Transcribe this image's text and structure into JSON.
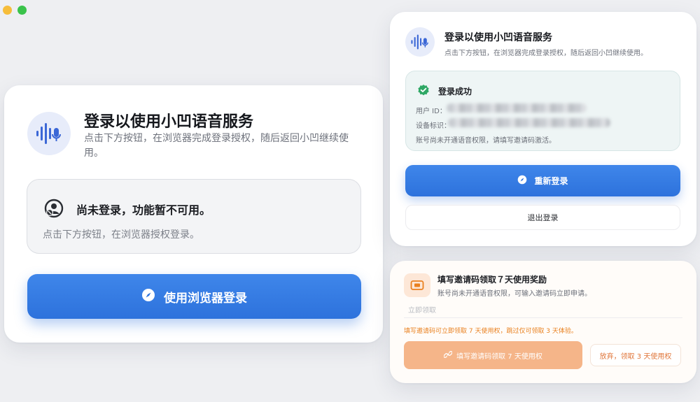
{
  "window": {
    "traffic_colors": [
      "#f6bd3b",
      "#3ac34b"
    ]
  },
  "left_card": {
    "title": "登录以使用小凹语音服务",
    "subtitle": "点击下方按钮，在浏览器完成登录授权，随后返回小凹继续使用。",
    "status": {
      "title": "尚未登录，功能暂不可用。",
      "description": "点击下方按钮，在浏览器授权登录。"
    },
    "login_button_label": "使用浏览器登录"
  },
  "right_top_card": {
    "title": "登录以使用小凹语音服务",
    "subtitle": "点击下方按钮，在浏览器完成登录授权，随后返回小凹继续使用。",
    "success": {
      "title": "登录成功",
      "user_id_label": "用户 ID：",
      "device_label": "设备标识：",
      "note": "账号尚未开通语音权限，请填写邀请码激活。"
    },
    "relogin_label": "重新登录",
    "logout_label": "退出登录"
  },
  "right_bottom_card": {
    "title": "填写邀请码领取７天使用奖励",
    "subtitle": "账号尚未开通语音权限，可输入邀请码立即申请。",
    "input_placeholder": "立即领取",
    "tip": "填写邀请码可立即领取 7 天使用权，跳过仅可领取 3 天体验。",
    "fill_button_label": "填写邀请码领取 7 天使用权",
    "giveup_button_label": "放弃，领取 3 天使用权"
  },
  "colors": {
    "primary_blue": "#2d72dc",
    "success_green": "#2fa865",
    "orange_accent": "#e9801f",
    "orange_button": "#f5b589"
  },
  "icons": {
    "mic": "voice-wave-mic-icon",
    "user_status": "user-slash-icon",
    "compass": "compass-icon",
    "check": "check-shield-icon",
    "ticket": "ticket-icon",
    "link": "link-icon"
  }
}
